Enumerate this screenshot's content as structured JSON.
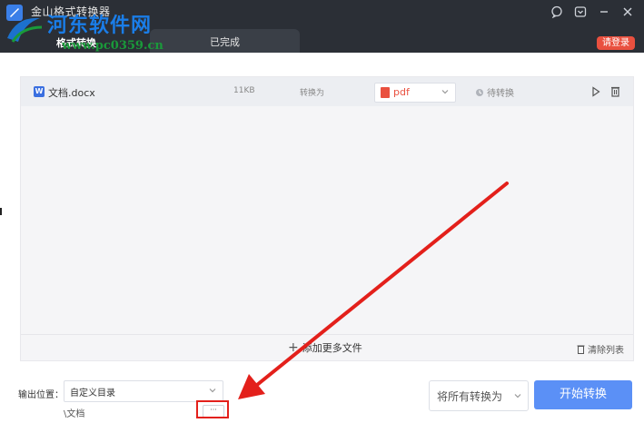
{
  "app": {
    "title": "金山格式转换器",
    "subtitle": "格式转换"
  },
  "tabs": {
    "done": "已完成"
  },
  "header": {
    "login": "请登录"
  },
  "watermark": {
    "text": "河东软件网",
    "url": "www.pc0359.cn"
  },
  "file_row": {
    "name": "文档.docx",
    "size": "11KB",
    "convert_label": "转换为",
    "format": "pdf",
    "status": "待转换"
  },
  "panel": {
    "add_more": "添加更多文件",
    "clear": "清除列表"
  },
  "output": {
    "label": "输出位置：",
    "select": "自定义目录",
    "path": "\\文档",
    "browse": "···"
  },
  "convert_all": "将所有转换为",
  "start": "开始转换",
  "colors": {
    "titlebar": "#2b2f36",
    "accent": "#5b90f6",
    "pdf": "#e9503f",
    "annotation": "#e3201b"
  }
}
